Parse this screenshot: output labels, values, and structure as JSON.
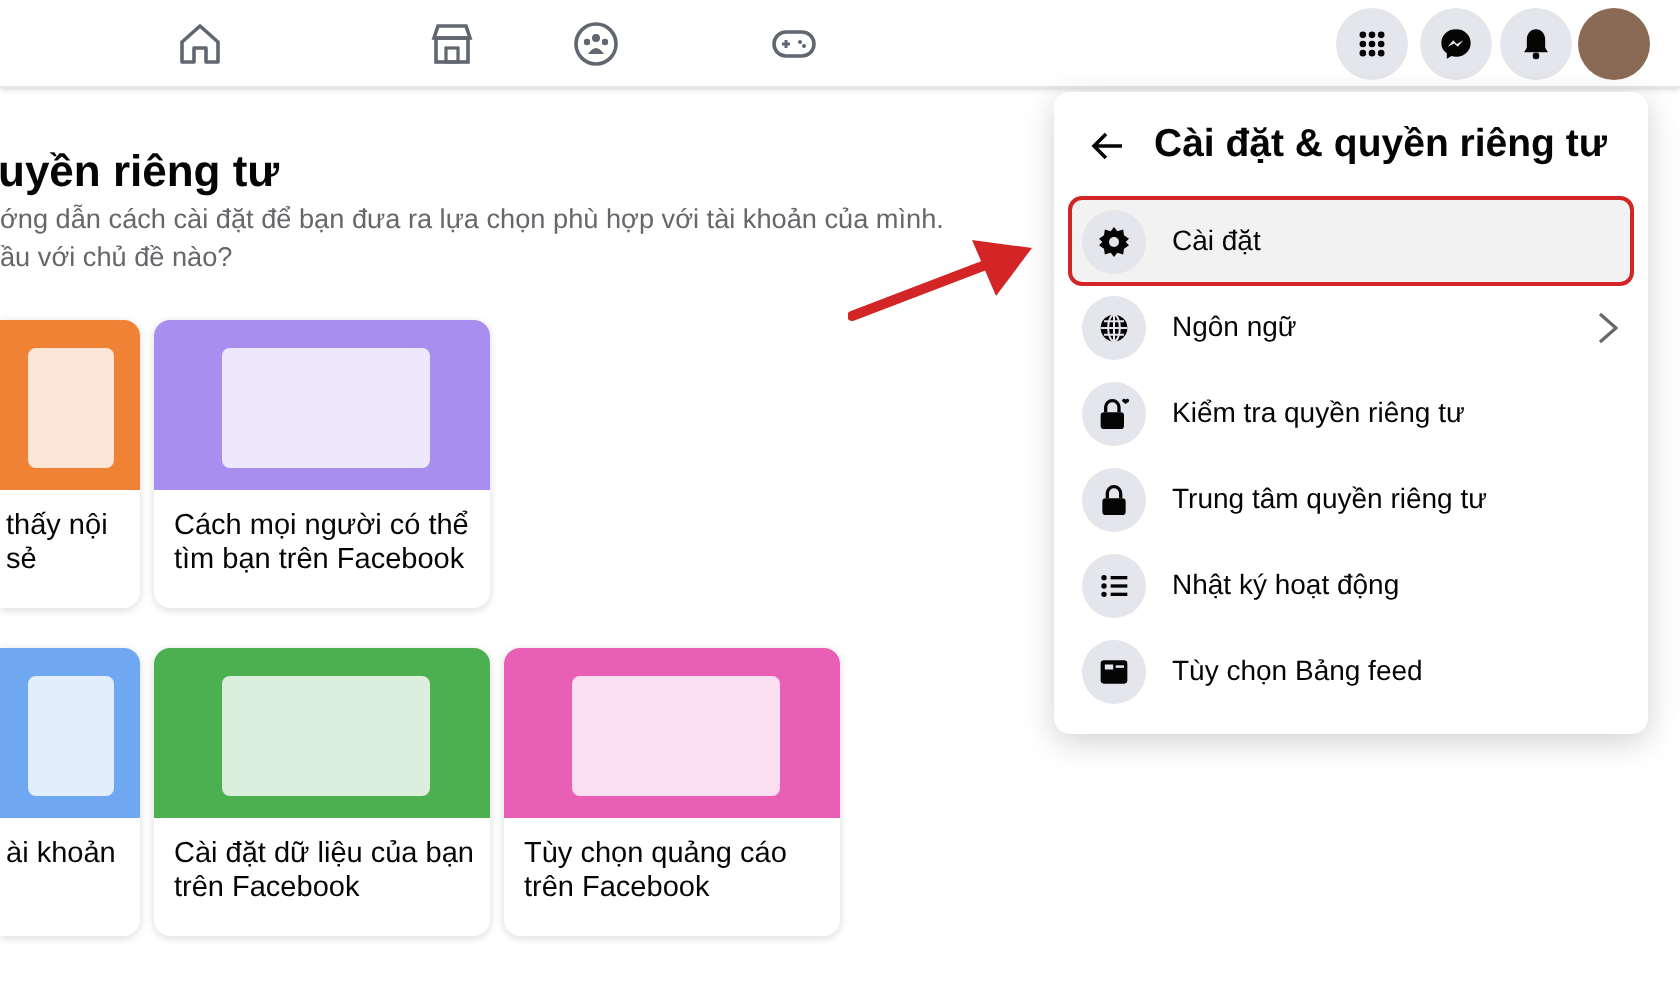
{
  "top_nav": {
    "tabs": [
      {
        "selected": false
      },
      {
        "selected": false
      },
      {
        "selected": false
      },
      {
        "selected": false
      }
    ]
  },
  "page": {
    "heading": "uyền riêng tư",
    "intro_lines": [
      "ớng dẫn cách cài đặt để bạn đưa ra lựa chọn phù hợp với tài khoản của mình.",
      "ầu với chủ đề nào?"
    ],
    "cards": [
      {
        "title_lines": [
          "thấy nội",
          "sẻ"
        ],
        "color": "#f08236"
      },
      {
        "title_lines": [
          "Cách mọi người có thể",
          "tìm bạn trên Facebook"
        ],
        "color": "#a98ef0"
      },
      {
        "title_lines": [
          "ài khoản"
        ],
        "color": "#6fa8f0"
      },
      {
        "title_lines": [
          "Cài đặt dữ liệu của bạn",
          "trên Facebook"
        ],
        "color": "#4caf50"
      },
      {
        "title_lines": [
          "Tùy chọn quảng cáo",
          "trên Facebook"
        ],
        "color": "#e95fb6"
      }
    ]
  },
  "menu": {
    "title": "Cài đặt & quyền riêng tư",
    "items": [
      {
        "label": "Cài đặt",
        "selected": true,
        "submenu": false
      },
      {
        "label": "Ngôn ngữ",
        "selected": false,
        "submenu": true
      },
      {
        "label": "Kiểm tra quyền riêng tư",
        "selected": false,
        "submenu": false
      },
      {
        "label": "Trung tâm quyền riêng tư",
        "selected": false,
        "submenu": false
      },
      {
        "label": "Nhật ký hoạt động",
        "selected": false,
        "submenu": false
      },
      {
        "label": "Tùy chọn Bảng feed",
        "selected": false,
        "submenu": false
      }
    ]
  }
}
